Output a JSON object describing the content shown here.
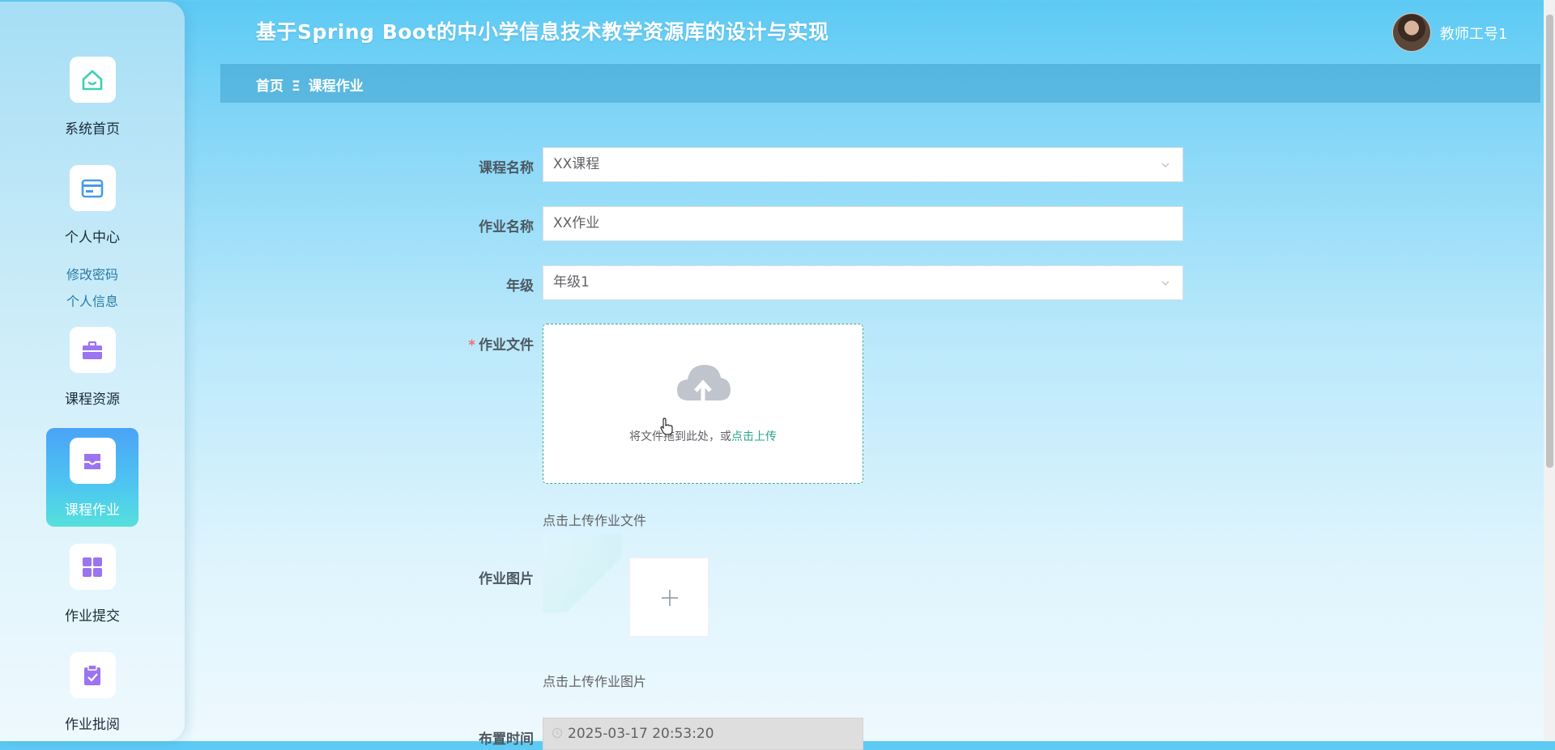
{
  "app": {
    "title": "基于Spring Boot的中小学信息技术教学资源库的设计与实现"
  },
  "user": {
    "name": "教师工号1"
  },
  "breadcrumb": {
    "home": "首页",
    "separator": "Ξ",
    "current": "课程作业"
  },
  "sidebar": {
    "items": [
      {
        "label": "系统首页",
        "icon": "home-icon"
      },
      {
        "label": "个人中心",
        "icon": "card-icon"
      },
      {
        "label": "课程资源",
        "icon": "briefcase-icon"
      },
      {
        "label": "课程作业",
        "icon": "inbox-icon",
        "active": true
      },
      {
        "label": "作业提交",
        "icon": "grid-icon"
      },
      {
        "label": "作业批阅",
        "icon": "clipboard-check-icon"
      }
    ],
    "sub_links": [
      "修改密码",
      "个人信息"
    ]
  },
  "form": {
    "course_name": {
      "label": "课程名称",
      "value": "XX课程"
    },
    "homework_name": {
      "label": "作业名称",
      "value": "XX作业"
    },
    "grade": {
      "label": "年级",
      "value": "年级1"
    },
    "homework_file": {
      "label": "作业文件",
      "drop_text": "将文件拖到此处，或",
      "drop_link": "点击上传",
      "tip": "点击上传作业文件"
    },
    "homework_image": {
      "label": "作业图片",
      "tip": "点击上传作业图片"
    },
    "assign_time": {
      "label": "布置时间",
      "value": "2025-03-17 20:53:20"
    }
  },
  "colors": {
    "accent": "#2aa38a",
    "required": "#f56c6c",
    "active_nav_start": "#4aa3f7",
    "active_nav_end": "#55e0dc"
  }
}
